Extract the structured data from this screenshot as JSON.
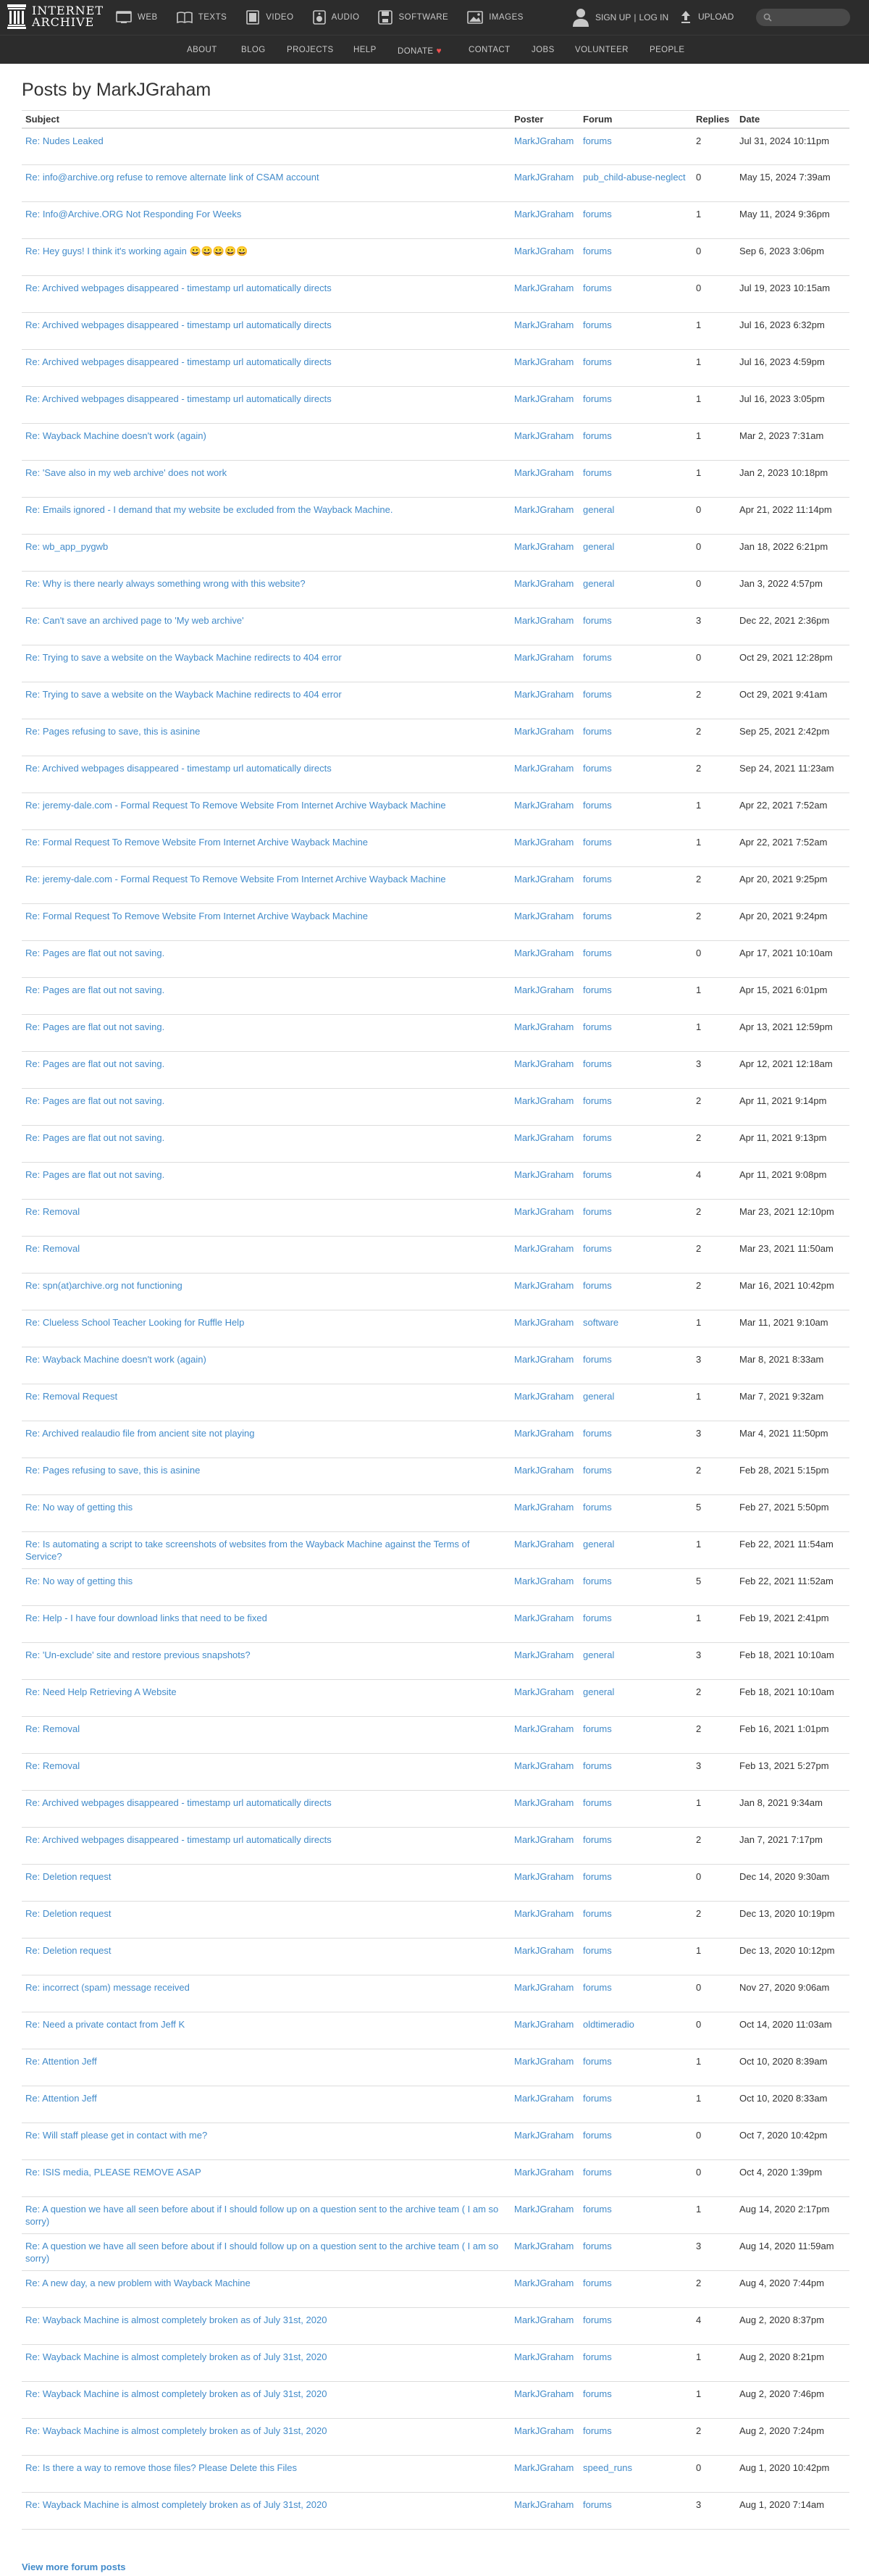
{
  "logo": {
    "line1": "INTERNET",
    "line2": "ARCHIVE"
  },
  "nav": {
    "media": [
      {
        "label": "WEB",
        "icon": "web-icon"
      },
      {
        "label": "TEXTS",
        "icon": "texts-icon"
      },
      {
        "label": "VIDEO",
        "icon": "video-icon"
      },
      {
        "label": "AUDIO",
        "icon": "audio-icon"
      },
      {
        "label": "SOFTWARE",
        "icon": "software-icon"
      },
      {
        "label": "IMAGES",
        "icon": "images-icon"
      }
    ],
    "signup": "SIGN UP",
    "separator": "|",
    "login": "LOG IN",
    "upload": "UPLOAD",
    "search_placeholder": ""
  },
  "subnav": [
    "ABOUT",
    "BLOG",
    "PROJECTS",
    "HELP",
    "DONATE",
    "CONTACT",
    "JOBS",
    "VOLUNTEER",
    "PEOPLE"
  ],
  "colors": {
    "link": "#428bca",
    "topbar": "#2c2c2c",
    "donate_heart": "#f04f4f"
  },
  "page": {
    "title": "Posts by MarkJGraham",
    "view_more": "View more forum posts"
  },
  "table": {
    "headers": {
      "subject": "Subject",
      "poster": "Poster",
      "forum": "Forum",
      "replies": "Replies",
      "date": "Date"
    },
    "rows": [
      {
        "subject": "Re: Nudes Leaked",
        "poster": "MarkJGraham",
        "forum": "forums",
        "replies": "2",
        "date": "Jul 31, 2024 10:11pm"
      },
      {
        "subject": "Re: info@archive.org refuse to remove alternate link of CSAM account",
        "poster": "MarkJGraham",
        "forum": "pub_child-abuse-neglect",
        "replies": "0",
        "date": "May 15, 2024 7:39am"
      },
      {
        "subject": "Re: Info@Archive.ORG Not Responding For Weeks",
        "poster": "MarkJGraham",
        "forum": "forums",
        "replies": "1",
        "date": "May 11, 2024 9:36pm"
      },
      {
        "subject": "Re: Hey guys! I think it's working again 😀😀😀😀😀",
        "poster": "MarkJGraham",
        "forum": "forums",
        "replies": "0",
        "date": "Sep 6, 2023 3:06pm"
      },
      {
        "subject": "Re: Archived webpages disappeared - timestamp url automatically directs",
        "poster": "MarkJGraham",
        "forum": "forums",
        "replies": "0",
        "date": "Jul 19, 2023 10:15am"
      },
      {
        "subject": "Re: Archived webpages disappeared - timestamp url automatically directs",
        "poster": "MarkJGraham",
        "forum": "forums",
        "replies": "1",
        "date": "Jul 16, 2023 6:32pm"
      },
      {
        "subject": "Re: Archived webpages disappeared - timestamp url automatically directs",
        "poster": "MarkJGraham",
        "forum": "forums",
        "replies": "1",
        "date": "Jul 16, 2023 4:59pm"
      },
      {
        "subject": "Re: Archived webpages disappeared - timestamp url automatically directs",
        "poster": "MarkJGraham",
        "forum": "forums",
        "replies": "1",
        "date": "Jul 16, 2023 3:05pm"
      },
      {
        "subject": "Re: Wayback Machine doesn't work (again)",
        "poster": "MarkJGraham",
        "forum": "forums",
        "replies": "1",
        "date": "Mar 2, 2023 7:31am"
      },
      {
        "subject": "Re: 'Save also in my web archive' does not work",
        "poster": "MarkJGraham",
        "forum": "forums",
        "replies": "1",
        "date": "Jan 2, 2023 10:18pm"
      },
      {
        "subject": "Re: Emails ignored - I demand that my website be excluded from the Wayback Machine.",
        "poster": "MarkJGraham",
        "forum": "general",
        "replies": "0",
        "date": "Apr 21, 2022 11:14pm"
      },
      {
        "subject": "Re: wb_app_pygwb",
        "poster": "MarkJGraham",
        "forum": "general",
        "replies": "0",
        "date": "Jan 18, 2022 6:21pm"
      },
      {
        "subject": "Re: Why is there nearly always something wrong with this website?",
        "poster": "MarkJGraham",
        "forum": "general",
        "replies": "0",
        "date": "Jan 3, 2022 4:57pm"
      },
      {
        "subject": "Re: Can't save an archived page to 'My web archive'",
        "poster": "MarkJGraham",
        "forum": "forums",
        "replies": "3",
        "date": "Dec 22, 2021 2:36pm"
      },
      {
        "subject": "Re: Trying to save a website on the Wayback Machine redirects to 404 error",
        "poster": "MarkJGraham",
        "forum": "forums",
        "replies": "0",
        "date": "Oct 29, 2021 12:28pm"
      },
      {
        "subject": "Re: Trying to save a website on the Wayback Machine redirects to 404 error",
        "poster": "MarkJGraham",
        "forum": "forums",
        "replies": "2",
        "date": "Oct 29, 2021 9:41am"
      },
      {
        "subject": "Re: Pages refusing to save, this is asinine",
        "poster": "MarkJGraham",
        "forum": "forums",
        "replies": "2",
        "date": "Sep 25, 2021 2:42pm"
      },
      {
        "subject": "Re: Archived webpages disappeared - timestamp url automatically directs",
        "poster": "MarkJGraham",
        "forum": "forums",
        "replies": "2",
        "date": "Sep 24, 2021 11:23am"
      },
      {
        "subject": "Re: jeremy-dale.com - Formal Request To Remove Website From Internet Archive Wayback Machine",
        "poster": "MarkJGraham",
        "forum": "forums",
        "replies": "1",
        "date": "Apr 22, 2021 7:52am"
      },
      {
        "subject": "Re: Formal Request To Remove Website From Internet Archive Wayback Machine",
        "poster": "MarkJGraham",
        "forum": "forums",
        "replies": "1",
        "date": "Apr 22, 2021 7:52am"
      },
      {
        "subject": "Re: jeremy-dale.com - Formal Request To Remove Website From Internet Archive Wayback Machine",
        "poster": "MarkJGraham",
        "forum": "forums",
        "replies": "2",
        "date": "Apr 20, 2021 9:25pm"
      },
      {
        "subject": "Re: Formal Request To Remove Website From Internet Archive Wayback Machine",
        "poster": "MarkJGraham",
        "forum": "forums",
        "replies": "2",
        "date": "Apr 20, 2021 9:24pm"
      },
      {
        "subject": "Re: Pages are flat out not saving.",
        "poster": "MarkJGraham",
        "forum": "forums",
        "replies": "0",
        "date": "Apr 17, 2021 10:10am"
      },
      {
        "subject": "Re: Pages are flat out not saving.",
        "poster": "MarkJGraham",
        "forum": "forums",
        "replies": "1",
        "date": "Apr 15, 2021 6:01pm"
      },
      {
        "subject": "Re: Pages are flat out not saving.",
        "poster": "MarkJGraham",
        "forum": "forums",
        "replies": "1",
        "date": "Apr 13, 2021 12:59pm"
      },
      {
        "subject": "Re: Pages are flat out not saving.",
        "poster": "MarkJGraham",
        "forum": "forums",
        "replies": "3",
        "date": "Apr 12, 2021 12:18am"
      },
      {
        "subject": "Re: Pages are flat out not saving.",
        "poster": "MarkJGraham",
        "forum": "forums",
        "replies": "2",
        "date": "Apr 11, 2021 9:14pm"
      },
      {
        "subject": "Re: Pages are flat out not saving.",
        "poster": "MarkJGraham",
        "forum": "forums",
        "replies": "2",
        "date": "Apr 11, 2021 9:13pm"
      },
      {
        "subject": "Re: Pages are flat out not saving.",
        "poster": "MarkJGraham",
        "forum": "forums",
        "replies": "4",
        "date": "Apr 11, 2021 9:08pm"
      },
      {
        "subject": "Re: Removal",
        "poster": "MarkJGraham",
        "forum": "forums",
        "replies": "2",
        "date": "Mar 23, 2021 12:10pm"
      },
      {
        "subject": "Re: Removal",
        "poster": "MarkJGraham",
        "forum": "forums",
        "replies": "2",
        "date": "Mar 23, 2021 11:50am"
      },
      {
        "subject": "Re: spn(at)archive.org not functioning",
        "poster": "MarkJGraham",
        "forum": "forums",
        "replies": "2",
        "date": "Mar 16, 2021 10:42pm"
      },
      {
        "subject": "Re: Clueless School Teacher Looking for Ruffle Help",
        "poster": "MarkJGraham",
        "forum": "software",
        "replies": "1",
        "date": "Mar 11, 2021 9:10am"
      },
      {
        "subject": "Re: Wayback Machine doesn't work (again)",
        "poster": "MarkJGraham",
        "forum": "forums",
        "replies": "3",
        "date": "Mar 8, 2021 8:33am"
      },
      {
        "subject": "Re: Removal Request",
        "poster": "MarkJGraham",
        "forum": "general",
        "replies": "1",
        "date": "Mar 7, 2021 9:32am"
      },
      {
        "subject": "Re: Archived realaudio file from ancient site not playing",
        "poster": "MarkJGraham",
        "forum": "forums",
        "replies": "3",
        "date": "Mar 4, 2021 11:50pm"
      },
      {
        "subject": "Re: Pages refusing to save, this is asinine",
        "poster": "MarkJGraham",
        "forum": "forums",
        "replies": "2",
        "date": "Feb 28, 2021 5:15pm"
      },
      {
        "subject": "Re: No way of getting this",
        "poster": "MarkJGraham",
        "forum": "forums",
        "replies": "5",
        "date": "Feb 27, 2021 5:50pm"
      },
      {
        "subject": "Re: Is automating a script to take screenshots of websites from the Wayback Machine against the Terms of Service?",
        "poster": "MarkJGraham",
        "forum": "general",
        "replies": "1",
        "date": "Feb 22, 2021 11:54am"
      },
      {
        "subject": "Re: No way of getting this",
        "poster": "MarkJGraham",
        "forum": "forums",
        "replies": "5",
        "date": "Feb 22, 2021 11:52am"
      },
      {
        "subject": "Re: Help - I have four download links that need to be fixed",
        "poster": "MarkJGraham",
        "forum": "forums",
        "replies": "1",
        "date": "Feb 19, 2021 2:41pm"
      },
      {
        "subject": "Re: 'Un-exclude' site and restore previous snapshots?",
        "poster": "MarkJGraham",
        "forum": "general",
        "replies": "3",
        "date": "Feb 18, 2021 10:10am"
      },
      {
        "subject": "Re: Need Help Retrieving A Website",
        "poster": "MarkJGraham",
        "forum": "general",
        "replies": "2",
        "date": "Feb 18, 2021 10:10am"
      },
      {
        "subject": "Re: Removal",
        "poster": "MarkJGraham",
        "forum": "forums",
        "replies": "2",
        "date": "Feb 16, 2021 1:01pm"
      },
      {
        "subject": "Re: Removal",
        "poster": "MarkJGraham",
        "forum": "forums",
        "replies": "3",
        "date": "Feb 13, 2021 5:27pm"
      },
      {
        "subject": "Re: Archived webpages disappeared - timestamp url automatically directs",
        "poster": "MarkJGraham",
        "forum": "forums",
        "replies": "1",
        "date": "Jan 8, 2021 9:34am"
      },
      {
        "subject": "Re: Archived webpages disappeared - timestamp url automatically directs",
        "poster": "MarkJGraham",
        "forum": "forums",
        "replies": "2",
        "date": "Jan 7, 2021 7:17pm"
      },
      {
        "subject": "Re: Deletion request",
        "poster": "MarkJGraham",
        "forum": "forums",
        "replies": "0",
        "date": "Dec 14, 2020 9:30am"
      },
      {
        "subject": "Re: Deletion request",
        "poster": "MarkJGraham",
        "forum": "forums",
        "replies": "2",
        "date": "Dec 13, 2020 10:19pm"
      },
      {
        "subject": "Re: Deletion request",
        "poster": "MarkJGraham",
        "forum": "forums",
        "replies": "1",
        "date": "Dec 13, 2020 10:12pm"
      },
      {
        "subject": "Re: incorrect (spam) message received",
        "poster": "MarkJGraham",
        "forum": "forums",
        "replies": "0",
        "date": "Nov 27, 2020 9:06am"
      },
      {
        "subject": "Re: Need a private contact from Jeff K",
        "poster": "MarkJGraham",
        "forum": "oldtimeradio",
        "replies": "0",
        "date": "Oct 14, 2020 11:03am"
      },
      {
        "subject": "Re: Attention Jeff",
        "poster": "MarkJGraham",
        "forum": "forums",
        "replies": "1",
        "date": "Oct 10, 2020 8:39am"
      },
      {
        "subject": "Re: Attention Jeff",
        "poster": "MarkJGraham",
        "forum": "forums",
        "replies": "1",
        "date": "Oct 10, 2020 8:33am"
      },
      {
        "subject": "Re: Will staff please get in contact with me?",
        "poster": "MarkJGraham",
        "forum": "forums",
        "replies": "0",
        "date": "Oct 7, 2020 10:42pm"
      },
      {
        "subject": "Re: ISIS media, PLEASE REMOVE ASAP",
        "poster": "MarkJGraham",
        "forum": "forums",
        "replies": "0",
        "date": "Oct 4, 2020 1:39pm"
      },
      {
        "subject": "Re: A question we have all seen before about if I should follow up on a question sent to the archive team ( I am so sorry)",
        "poster": "MarkJGraham",
        "forum": "forums",
        "replies": "1",
        "date": "Aug 14, 2020 2:17pm"
      },
      {
        "subject": "Re: A question we have all seen before about if I should follow up on a question sent to the archive team ( I am so sorry)",
        "poster": "MarkJGraham",
        "forum": "forums",
        "replies": "3",
        "date": "Aug 14, 2020 11:59am"
      },
      {
        "subject": "Re: A new day, a new problem with Wayback Machine",
        "poster": "MarkJGraham",
        "forum": "forums",
        "replies": "2",
        "date": "Aug 4, 2020 7:44pm"
      },
      {
        "subject": "Re: Wayback Machine is almost completely broken as of July 31st, 2020",
        "poster": "MarkJGraham",
        "forum": "forums",
        "replies": "4",
        "date": "Aug 2, 2020 8:37pm"
      },
      {
        "subject": "Re: Wayback Machine is almost completely broken as of July 31st, 2020",
        "poster": "MarkJGraham",
        "forum": "forums",
        "replies": "1",
        "date": "Aug 2, 2020 8:21pm"
      },
      {
        "subject": "Re: Wayback Machine is almost completely broken as of July 31st, 2020",
        "poster": "MarkJGraham",
        "forum": "forums",
        "replies": "1",
        "date": "Aug 2, 2020 7:46pm"
      },
      {
        "subject": "Re: Wayback Machine is almost completely broken as of July 31st, 2020",
        "poster": "MarkJGraham",
        "forum": "forums",
        "replies": "2",
        "date": "Aug 2, 2020 7:24pm"
      },
      {
        "subject": "Re: Is there a way to remove those files? Please Delete this Files",
        "poster": "MarkJGraham",
        "forum": "speed_runs",
        "replies": "0",
        "date": "Aug 1, 2020 10:42pm"
      },
      {
        "subject": "Re: Wayback Machine is almost completely broken as of July 31st, 2020",
        "poster": "MarkJGraham",
        "forum": "forums",
        "replies": "3",
        "date": "Aug 1, 2020 7:14am"
      }
    ]
  }
}
